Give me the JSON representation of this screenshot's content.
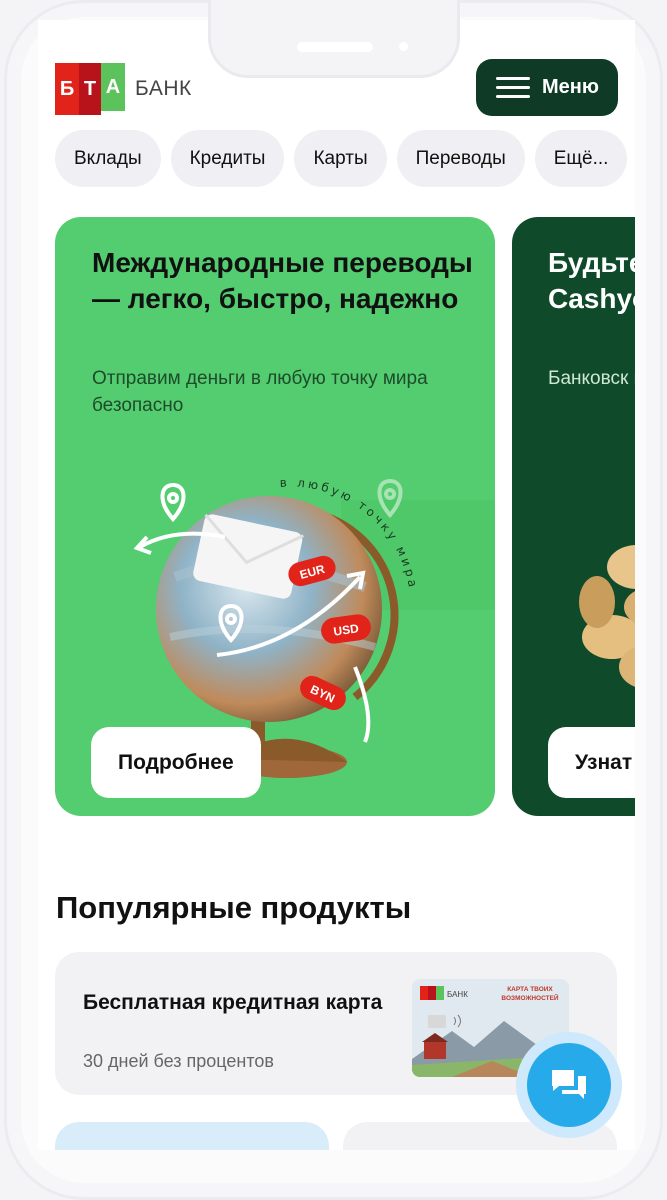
{
  "header": {
    "logo_letters": [
      "Б",
      "Т",
      "А"
    ],
    "logo_text": "БАНК",
    "menu_label": "Меню"
  },
  "nav": {
    "chips": [
      "Вклады",
      "Кредиты",
      "Карты",
      "Переводы",
      "Ещё..."
    ]
  },
  "banners": [
    {
      "title": "Международные переводы — легко, быстро, надежно",
      "subtitle": "Отправим деньги в любую точку мира безопасно",
      "button": "Подробнее",
      "art_text": "в любую точку мира",
      "currency_tags": [
        "EUR",
        "USD",
        "BYN"
      ],
      "colors": {
        "background": "#53cd6f",
        "tag": "#e2231a"
      }
    },
    {
      "title": "Будьте покупк Cashyo",
      "subtitle": "Банковск ваших по",
      "button": "Узнат",
      "colors": {
        "background": "#0f4a2a"
      }
    }
  ],
  "popular": {
    "title": "Популярные продукты",
    "products": [
      {
        "title": "Бесплатная кредитная карта",
        "subtitle": "30 дней без процентов",
        "card_image": {
          "bank_text": "БАНК",
          "caption": "КАРТА ТВОИХ ВОЗМОЖНОСТЕЙ"
        }
      }
    ]
  },
  "chat": {
    "icon": "chat-bubbles-icon",
    "color": "#27aae9"
  },
  "colors": {
    "accent_dark": "#0f3b26",
    "brand_red": "#e2231a",
    "brand_green": "#5cc25c"
  }
}
